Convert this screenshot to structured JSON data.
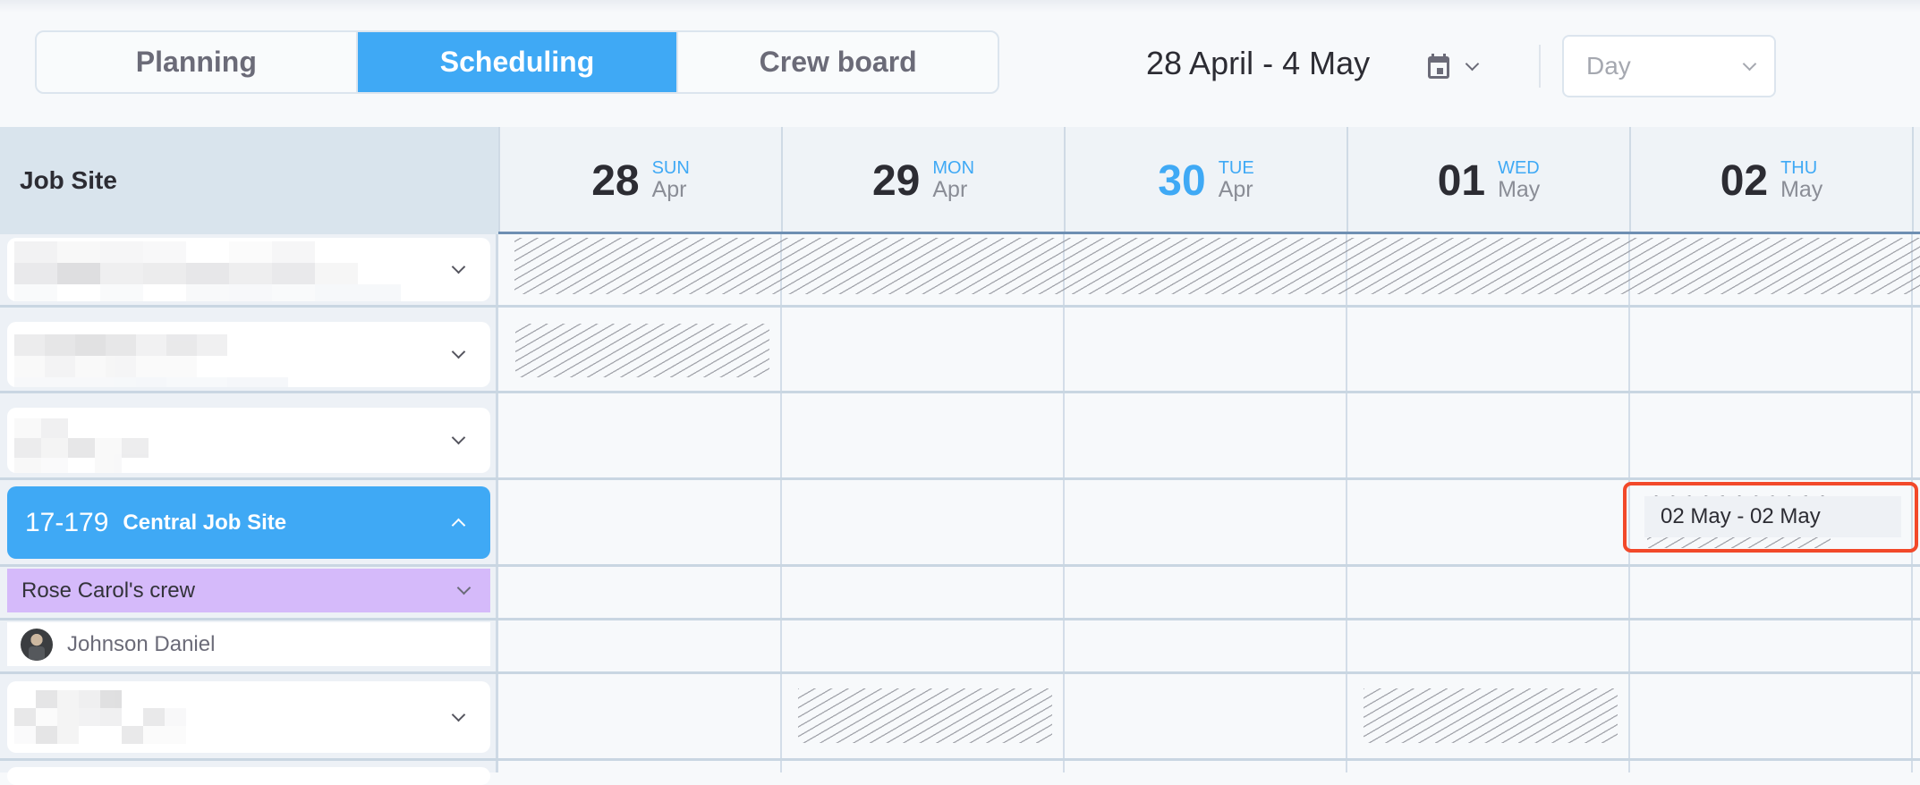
{
  "toolbar": {
    "tabs": [
      {
        "label": "Planning",
        "active": false
      },
      {
        "label": "Scheduling",
        "active": true
      },
      {
        "label": "Crew board",
        "active": false
      }
    ],
    "date_range": "28 April - 4 May",
    "calendar_icon": "calendar-icon",
    "view_select": {
      "value": "Day",
      "placeholder": "Day"
    }
  },
  "grid": {
    "left_header": "Job Site",
    "days": [
      {
        "num": "28",
        "dow": "SUN",
        "month": "Apr",
        "today": false
      },
      {
        "num": "29",
        "dow": "MON",
        "month": "Apr",
        "today": false
      },
      {
        "num": "30",
        "dow": "TUE",
        "month": "Apr",
        "today": true
      },
      {
        "num": "01",
        "dow": "WED",
        "month": "May",
        "today": false
      },
      {
        "num": "02",
        "dow": "THU",
        "month": "May",
        "today": false
      }
    ],
    "active_site": {
      "code": "17-179",
      "name": "Central Job Site"
    },
    "crew": {
      "label": "Rose Carol's crew"
    },
    "member": {
      "name": "Johnson Daniel"
    },
    "event": {
      "label": "02 May - 02 May"
    }
  },
  "colors": {
    "accent": "#3fa9f5",
    "crew": "#d5bafa",
    "highlight": "#f2492a"
  }
}
